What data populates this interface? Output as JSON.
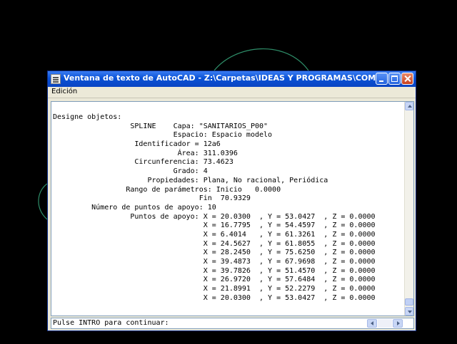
{
  "window": {
    "title": "Ventana de texto de AutoCAD - Z:\\Carpetas\\IDEAS Y PROGRAMAS\\COMANDOS\\PLANTA DI...",
    "menu": [
      "Edición"
    ]
  },
  "text_lines": [
    "Designe objetos:",
    "                  SPLINE    Capa: \"SANITARIOS_P00\"",
    "                            Espacio: Espacio modelo",
    "                   Identificador = 12a6",
    "                             Área: 311.0396",
    "                   Circunferencia: 73.4623",
    "                            Grado: 4",
    "                      Propiedades: Plana, No racional, Periódica",
    "                 Rango de parámetros: Inicio   0.0000",
    "                                  Fin  70.9329",
    "         Número de puntos de apoyo: 10",
    "                  Puntos de apoyo: X = 20.0300  , Y = 53.0427  , Z = 0.0000",
    "                                   X = 16.7795  , Y = 54.4597  , Z = 0.0000",
    "                                   X = 6.4014   , Y = 61.3261  , Z = 0.0000",
    "                                   X = 24.5627  , Y = 61.8055  , Z = 0.0000",
    "                                   X = 28.2450  , Y = 75.6250  , Z = 0.0000",
    "                                   X = 39.4873  , Y = 67.9698  , Z = 0.0000",
    "                                   X = 39.7826  , Y = 51.4570  , Z = 0.0000",
    "                                   X = 26.9720  , Y = 57.6484  , Z = 0.0000",
    "                                   X = 21.8991  , Y = 52.2279  , Z = 0.0000",
    "                                   X = 20.0300  , Y = 53.0427  , Z = 0.0000"
  ],
  "command_line": "Pulse INTRO para continuar:",
  "icons": {
    "app": "autocad-text-window-icon",
    "minimize": "minimize-icon",
    "maximize": "maximize-icon",
    "close": "close-icon"
  },
  "colors": {
    "desktop": "#000000",
    "titlebar": "#0a52d6",
    "curve": "#2f8f6a"
  }
}
